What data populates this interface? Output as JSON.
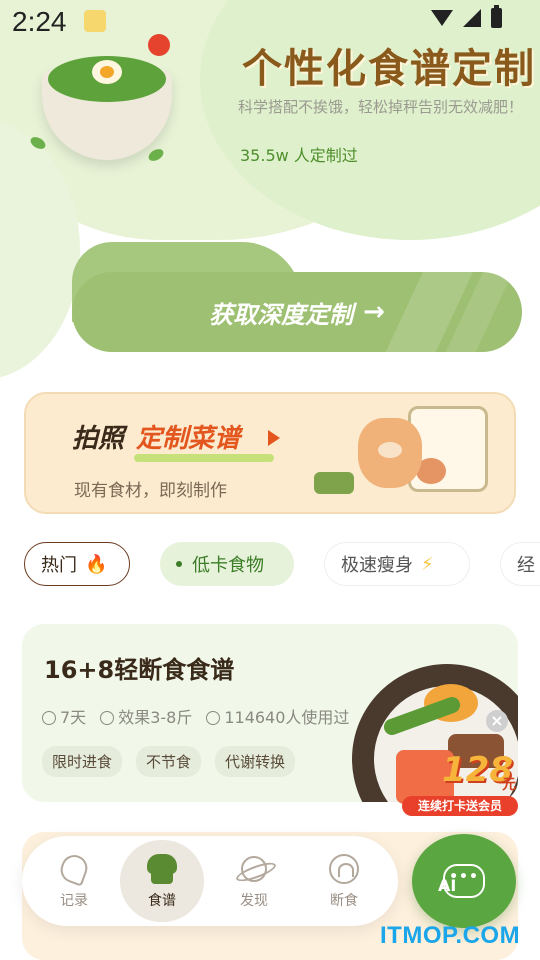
{
  "status_bar": {
    "time": "2:24"
  },
  "hero": {
    "title": "个性化食谱定制",
    "subtitle": "科学搭配不挨饿，轻松掉秤告别无效减肥！",
    "count_text": "35.5w 人定制过"
  },
  "cta": {
    "label": "获取深度定制",
    "arrow": "→"
  },
  "banner": {
    "title_part1": "拍照",
    "title_part2": "定制菜谱",
    "subtitle": "现有食材，即刻制作"
  },
  "categories": [
    {
      "label": "热门",
      "icon": "flame-icon",
      "glyph": "🔥"
    },
    {
      "label": "低卡食物",
      "selected": true
    },
    {
      "label": "极速瘦身",
      "icon": "bolt-icon",
      "glyph": "⚡"
    },
    {
      "label": "经"
    }
  ],
  "recipe": {
    "title": "16+8轻断食食谱",
    "duration": "7天",
    "effect": "效果3-8斤",
    "users": "114640人使用过",
    "tags": [
      "限时进食",
      "不节食",
      "代谢转换"
    ]
  },
  "promo": {
    "amount": "128",
    "unit": "元",
    "ribbon": "连续打卡送会员",
    "close": "×"
  },
  "tabbar": [
    {
      "label": "记录",
      "icon": "record-icon"
    },
    {
      "label": "食谱",
      "icon": "chef-hat-icon",
      "active": true
    },
    {
      "label": "发现",
      "icon": "planet-icon"
    },
    {
      "label": "断食",
      "icon": "fasting-icon"
    }
  ],
  "ai_button": {
    "label": "AI",
    "dots": "•••"
  },
  "watermark": "ITMOP.COM",
  "colors": {
    "primary_green": "#9ec072",
    "accent_orange": "#e3571f",
    "text_brown": "#8a5a1c",
    "ai_green": "#5aa640"
  }
}
